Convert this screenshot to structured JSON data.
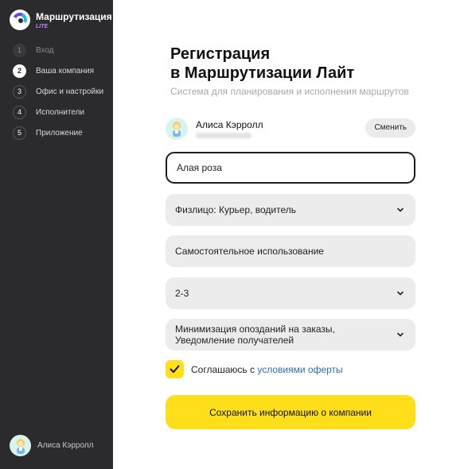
{
  "app": {
    "title": "Маршрутизация",
    "subtitle": "LITE"
  },
  "steps": [
    {
      "num": "1",
      "label": "Вход",
      "state": "done"
    },
    {
      "num": "2",
      "label": "Ваша компания",
      "state": "active"
    },
    {
      "num": "3",
      "label": "Офис и настройки",
      "state": "todo"
    },
    {
      "num": "4",
      "label": "Исполнители",
      "state": "todo"
    },
    {
      "num": "5",
      "label": "Приложение",
      "state": "todo"
    }
  ],
  "sidebar_user": {
    "name": "Алиса Кэрролл",
    "icon": "avatar-icon"
  },
  "page": {
    "title_line1": "Регистрация",
    "title_line2": "в Маршрутизации Лайт",
    "subtitle": "Система для планирования и исполнения маршрутов"
  },
  "account": {
    "name": "Алиса Кэрролл",
    "change_label": "Сменить"
  },
  "form": {
    "company_name": "Алая роза",
    "legal_type": "Физлицо: Курьер, водитель",
    "usage": "Самостоятельное использование",
    "team_size": "2-3",
    "goals_line1": "Минимизация опозданий на заказы,",
    "goals_line2": "Уведомление получателей"
  },
  "agreement": {
    "text": "Соглашаюсь с ",
    "link": "условиями оферты",
    "checked": true
  },
  "save_label": "Сохранить информацию о компании",
  "colors": {
    "accent": "#ffdf1a",
    "sidebar": "#2b2b2e",
    "link": "#2a6fb3"
  }
}
